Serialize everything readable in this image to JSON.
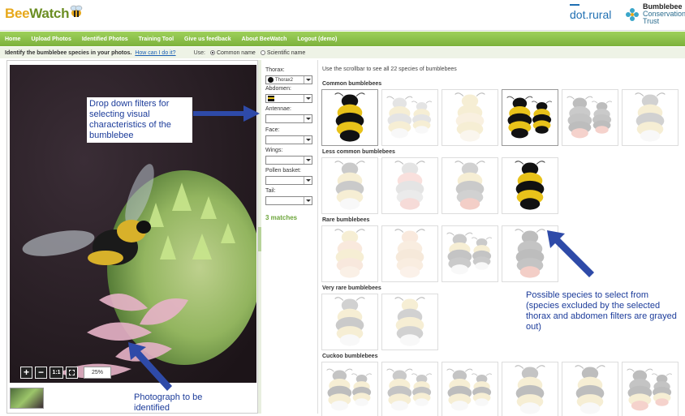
{
  "header": {
    "logo_bee": "Bee",
    "logo_watch": "Watch",
    "partner_dotrural": "dot.rural",
    "partner_bct_line1": "Bumblebee",
    "partner_bct_line2": "Conservation",
    "partner_bct_line3": "Trust"
  },
  "nav": {
    "items": [
      "Home",
      "Upload Photos",
      "Identified Photos",
      "Training Tool",
      "Give us feedback",
      "About BeeWatch",
      "Logout (demo)"
    ]
  },
  "instructions": {
    "question": "Identify the bumblebee species in your photos.",
    "help_link": "How can I do it?",
    "use_label": "Use:",
    "option_common": "Common name",
    "option_scientific": "Scientific name",
    "selected": "common"
  },
  "photo": {
    "zoom_value": "25%",
    "zoom_in": "+",
    "zoom_out": "−",
    "zoom_actual": "1:1"
  },
  "filters": {
    "thorax_label": "Thorax:",
    "thorax_value": "Thorax2",
    "abdomen_label": "Abdomen:",
    "antennae_label": "Antennae:",
    "face_label": "Face:",
    "wings_label": "Wings:",
    "pollen_label": "Pollen basket:",
    "tail_label": "Tail:",
    "matches": "3 matches"
  },
  "species_panel": {
    "scroll_hint": "Use the scrollbar to see all 22 species of bumblebees",
    "groups": [
      {
        "title": "Common bumblebees",
        "count": 6
      },
      {
        "title": "Less common bumblebees",
        "count": 4
      },
      {
        "title": "Rare bumblebees",
        "count": 4
      },
      {
        "title": "Very rare bumblebees",
        "count": 2
      },
      {
        "title": "Cuckoo bumblebees",
        "count": 6
      }
    ]
  },
  "annotations": {
    "filters_note": "Drop down filters for selecting visual characteristics of the bumblebee",
    "species_note": "Possible species to select from (species excluded by the selected thorax and abdomen filters are grayed out)",
    "photo_note": "Photograph to be identified"
  },
  "colors": {
    "nav_green": "#8bc34a",
    "matches_green": "#6ca53a",
    "annotation_blue": "#1c3c9a",
    "link_blue": "#1a5fb4"
  }
}
